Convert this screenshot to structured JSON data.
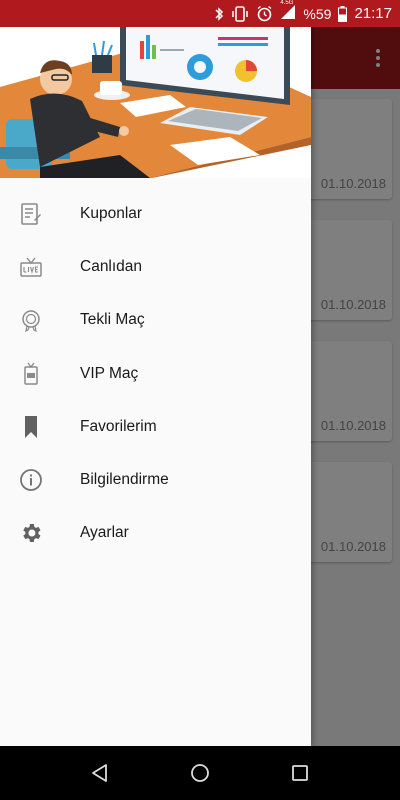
{
  "status_bar": {
    "network": "4.5G",
    "battery": "%59",
    "time": "21:17"
  },
  "background_list": {
    "dates": [
      "01.10.2018",
      "01.10.2018",
      "01.10.2018",
      "01.10.2018"
    ]
  },
  "drawer": {
    "items": [
      {
        "label": "Kuponlar",
        "icon": "coupon-icon"
      },
      {
        "label": "Canlıdan",
        "icon": "live-icon"
      },
      {
        "label": "Tekli Maç",
        "icon": "medal-icon"
      },
      {
        "label": "VIP Maç",
        "icon": "vip-icon"
      },
      {
        "label": "Favorilerim",
        "icon": "bookmark-icon"
      },
      {
        "label": "Bilgilendirme",
        "icon": "info-icon"
      },
      {
        "label": "Ayarlar",
        "icon": "gear-icon"
      }
    ]
  },
  "colors": {
    "status_bar": "#b0191e",
    "toolbar": "#a31a1c",
    "icon_gray": "#8a8a8a"
  }
}
